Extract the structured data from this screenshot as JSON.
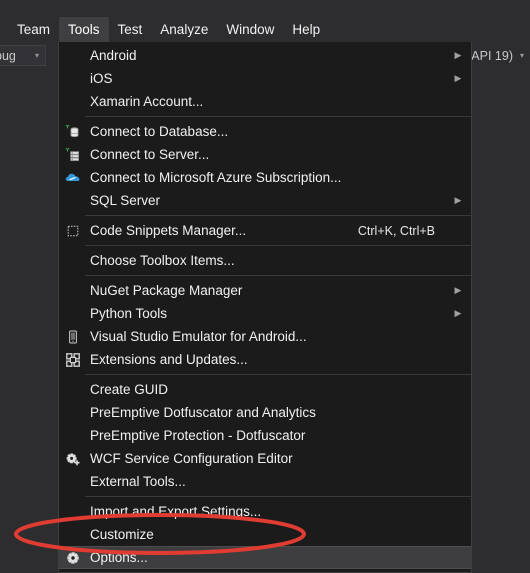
{
  "app": {
    "theme_background": "#2D2D30",
    "menu_background": "#1B1B1C",
    "accent_highlight": "#3E3E40",
    "annotation_color": "#E13C32"
  },
  "menubar": {
    "items": [
      {
        "label": "Team",
        "active": false
      },
      {
        "label": "Tools",
        "active": true
      },
      {
        "label": "Test",
        "active": false
      },
      {
        "label": "Analyze",
        "active": false
      },
      {
        "label": "Window",
        "active": false
      },
      {
        "label": "Help",
        "active": false
      }
    ]
  },
  "toolbar": {
    "debug_combo": {
      "value": "bug",
      "arrow": "▾"
    },
    "api_combo": {
      "value": "API 19)",
      "arrow": "▾"
    }
  },
  "tools_menu": {
    "name": "Tools",
    "groups": [
      {
        "items": [
          {
            "label": "Android",
            "icon": "none",
            "shortcut": "",
            "submenu": true
          },
          {
            "label": "iOS",
            "icon": "none",
            "shortcut": "",
            "submenu": true
          },
          {
            "label": "Xamarin Account...",
            "icon": "none",
            "shortcut": "",
            "submenu": false
          }
        ]
      },
      {
        "items": [
          {
            "label": "Connect to Database...",
            "icon": "database-icon",
            "shortcut": "",
            "submenu": false
          },
          {
            "label": "Connect to Server...",
            "icon": "server-icon",
            "shortcut": "",
            "submenu": false
          },
          {
            "label": "Connect to Microsoft Azure Subscription...",
            "icon": "azure-cloud-icon",
            "shortcut": "",
            "submenu": false
          },
          {
            "label": "SQL Server",
            "icon": "none",
            "shortcut": "",
            "submenu": true
          }
        ]
      },
      {
        "items": [
          {
            "label": "Code Snippets Manager...",
            "icon": "snippet-icon",
            "shortcut": "Ctrl+K, Ctrl+B",
            "submenu": false
          }
        ]
      },
      {
        "items": [
          {
            "label": "Choose Toolbox Items...",
            "icon": "none",
            "shortcut": "",
            "submenu": false
          }
        ]
      },
      {
        "items": [
          {
            "label": "NuGet Package Manager",
            "icon": "none",
            "shortcut": "",
            "submenu": true
          },
          {
            "label": "Python Tools",
            "icon": "none",
            "shortcut": "",
            "submenu": true
          },
          {
            "label": "Visual Studio Emulator for Android...",
            "icon": "phone-emulator-icon",
            "shortcut": "",
            "submenu": false
          },
          {
            "label": "Extensions and Updates...",
            "icon": "extensions-icon",
            "shortcut": "",
            "submenu": false
          }
        ]
      },
      {
        "items": [
          {
            "label": "Create GUID",
            "icon": "none",
            "shortcut": "",
            "submenu": false
          },
          {
            "label": "PreEmptive Dotfuscator and Analytics",
            "icon": "none",
            "shortcut": "",
            "submenu": false
          },
          {
            "label": "PreEmptive Protection - Dotfuscator",
            "icon": "none",
            "shortcut": "",
            "submenu": false
          },
          {
            "label": "WCF Service Configuration Editor",
            "icon": "wcf-gear-icon",
            "shortcut": "",
            "submenu": false
          },
          {
            "label": "External Tools...",
            "icon": "none",
            "shortcut": "",
            "submenu": false
          }
        ]
      },
      {
        "items": [
          {
            "label": "Import and Export Settings...",
            "icon": "none",
            "shortcut": "",
            "submenu": false
          },
          {
            "label": "Customize",
            "icon": "none",
            "shortcut": "",
            "submenu": false
          },
          {
            "label": "Options...",
            "icon": "options-gear-icon",
            "shortcut": "",
            "submenu": false,
            "highlighted": true
          }
        ]
      }
    ]
  },
  "annotation": {
    "shape": "ellipse",
    "target_label": "Options...",
    "color": "#E13C32"
  }
}
